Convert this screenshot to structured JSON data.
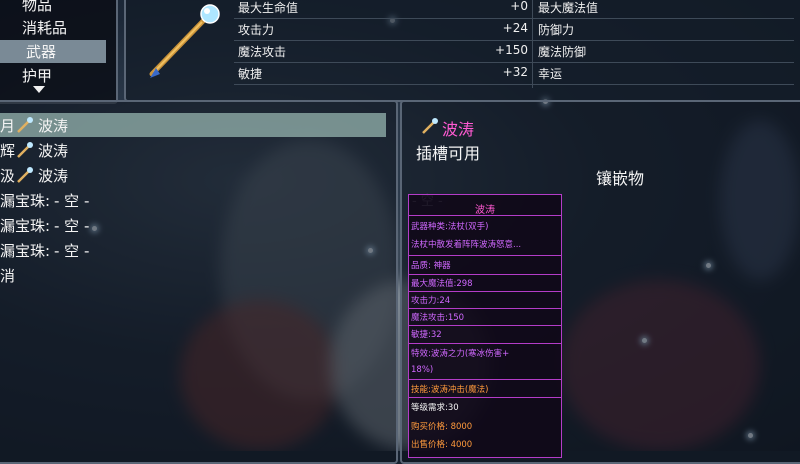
{
  "categories": [
    {
      "label": "物品",
      "selected": false
    },
    {
      "label": "消耗品",
      "selected": false
    },
    {
      "label": "武器",
      "selected": true
    },
    {
      "label": "护甲",
      "selected": false
    }
  ],
  "top_stats": [
    {
      "left": "最大生命值",
      "value": "+0",
      "right": "最大魔法值"
    },
    {
      "left": "攻击力",
      "value": "+24",
      "right": "防御力"
    },
    {
      "left": "魔法攻击",
      "value": "+150",
      "right": "魔法防御"
    },
    {
      "left": "敏捷",
      "value": "+32",
      "right": "幸运"
    }
  ],
  "equip_slots": [
    {
      "label": "月",
      "name": "波涛",
      "selected": true
    },
    {
      "label": "辉",
      "name": "波涛",
      "selected": false
    },
    {
      "label": "汲",
      "name": "波涛",
      "selected": false
    },
    {
      "label": "漏宝珠:",
      "name": "- 空 -",
      "selected": false
    },
    {
      "label": "漏宝珠:",
      "name": "- 空 -",
      "selected": false
    },
    {
      "label": "漏宝珠:",
      "name": "- 空 -",
      "selected": false
    },
    {
      "label": "消",
      "name": "",
      "selected": false
    }
  ],
  "detail": {
    "name": "波涛",
    "subtitle": "插槽可用",
    "inlay_label": "镶嵌物",
    "empty_slot": "- 空 -"
  },
  "tooltip": {
    "title": "波涛",
    "lines": [
      {
        "text": "武器种类:法杖(双手)",
        "color": "purple"
      },
      {
        "text": "法杖中散发着阵阵波涛怒意...",
        "color": "purple"
      },
      {
        "text": "品质: 神器",
        "color": "purple"
      },
      {
        "text": "最大魔法值:298",
        "color": "purple"
      },
      {
        "text": "攻击力:24",
        "color": "purple"
      },
      {
        "text": "魔法攻击:150",
        "color": "purple"
      },
      {
        "text": "敏捷:32",
        "color": "purple"
      },
      {
        "text": "特效:波涛之力(寒冰伤害+",
        "color": "purple"
      },
      {
        "text": "18%)",
        "color": "purple"
      },
      {
        "text": "技能:波涛冲击(魔法)",
        "color": "orange"
      },
      {
        "text": "等级需求:30",
        "color": "white"
      },
      {
        "text": "购买价格: 8000",
        "color": "orange"
      },
      {
        "text": "出售价格: 4000",
        "color": "orange"
      }
    ]
  },
  "colors": {
    "accent_magenta": "#ff5ad2",
    "tooltip_border": "#b43cc8",
    "selected_row": "#96b4af"
  },
  "icons": {
    "weapon": "magic-staff-icon",
    "scroll_indicator": "arrow-down-icon"
  }
}
